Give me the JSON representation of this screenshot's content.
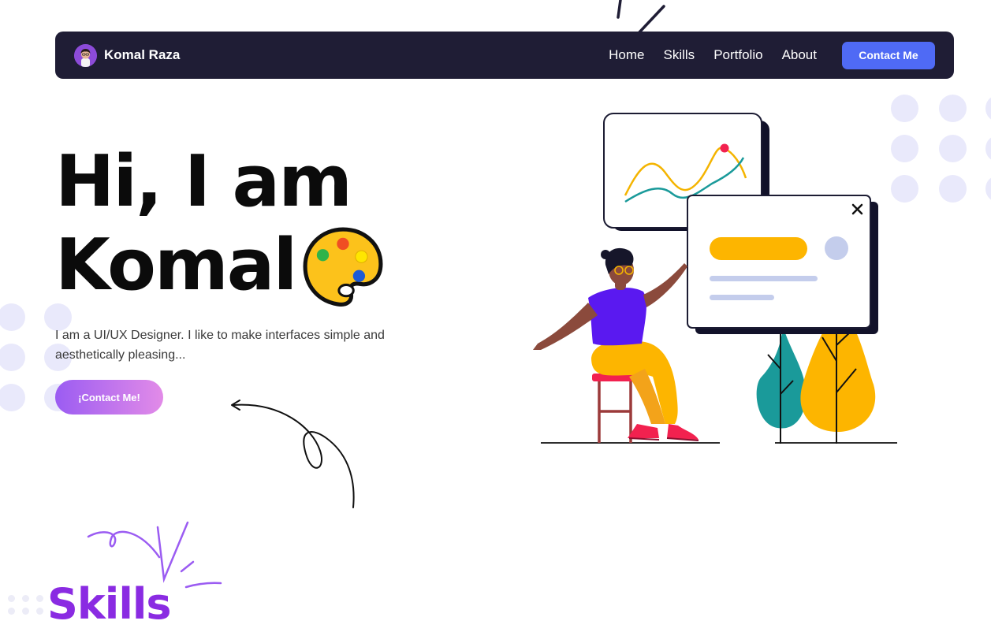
{
  "navbar": {
    "brand_name": "Komal Raza",
    "links": [
      {
        "label": "Home"
      },
      {
        "label": "Skills"
      },
      {
        "label": "Portfolio"
      },
      {
        "label": "About"
      }
    ],
    "cta_label": "Contact Me"
  },
  "hero": {
    "title_line1": "Hi, I am",
    "title_line2": "Komal",
    "emoji_icon": "artist-palette-icon",
    "description": "I am a UI/UX Designer. I like to make interfaces simple and aesthetically pleasing...",
    "button_label": "¡Contact Me!"
  },
  "skills": {
    "title": "Skills"
  },
  "colors": {
    "navbar_bg": "#1f1d35",
    "accent_blue": "#4f6af5",
    "button_gradient_start": "#9b5cf2",
    "button_gradient_end": "#e28be8",
    "skills_purple": "#8a2be2",
    "dot_lavender": "#e9e9fb"
  }
}
